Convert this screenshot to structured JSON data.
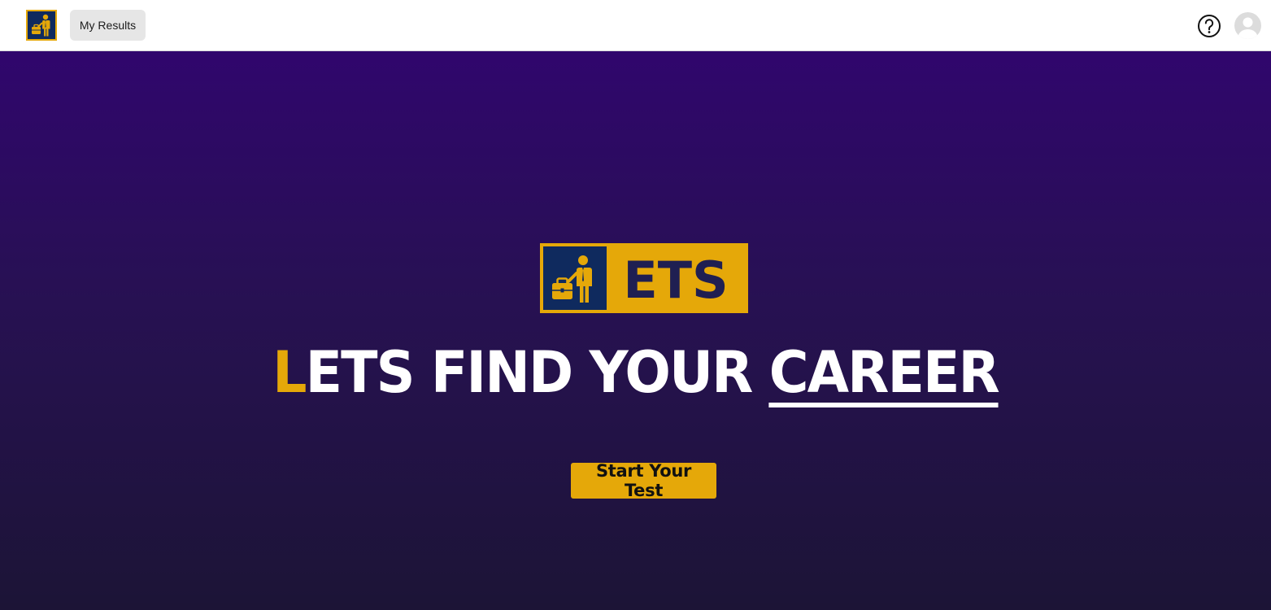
{
  "nav": {
    "logo_icon": "businessman-briefcase-icon",
    "my_results_label": "My Results",
    "help_icon": "question-mark-icon",
    "avatar_icon": "user-avatar-icon"
  },
  "hero": {
    "brand_logo_text": "ETS",
    "headline": {
      "first_letter": "L",
      "middle": "ETS FIND YOUR ",
      "underlined": "CAREER"
    },
    "cta_label": "Start Your Test"
  },
  "colors": {
    "brand_gold": "#e5a809",
    "brand_navy": "#0f2a5e",
    "hero_top": "#30066d",
    "hero_bottom": "#1c1436",
    "logo_text": "#1f1f52"
  }
}
